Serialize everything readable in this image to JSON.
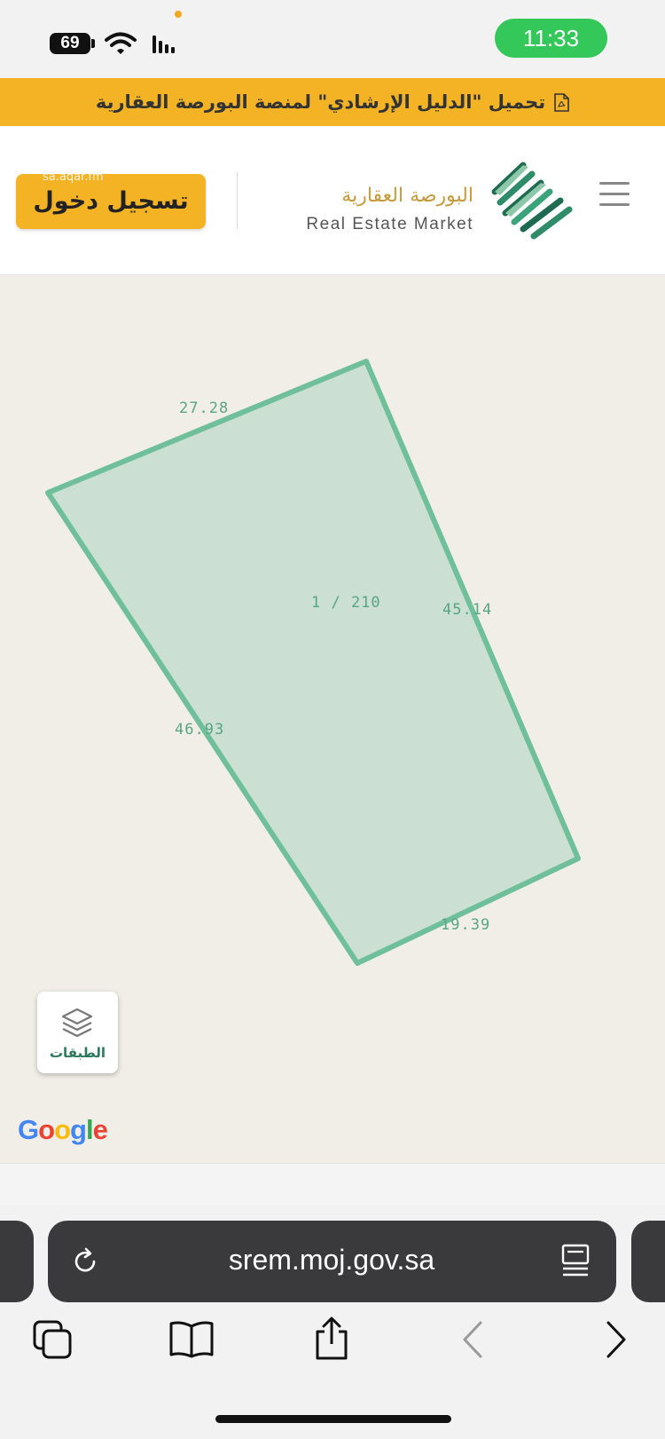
{
  "status_bar": {
    "battery": "69",
    "time": "11:33"
  },
  "banner": {
    "text": "تحميل \"الدليل الإرشادي\" لمنصة البورصة العقارية",
    "icon": "pdf-icon"
  },
  "header": {
    "login_label": "تسجيل دخول",
    "watermark": "sa.aqar.fm",
    "brand_ar": "البورصة العقارية",
    "brand_en": "Real Estate Market",
    "menu_icon": "hamburger-menu-icon",
    "logo_icon": "saudi-map-logo"
  },
  "map": {
    "parcel_label": "1 / 210",
    "dimensions": {
      "top": "27.28",
      "right": "45.14",
      "left": "46.93",
      "bottom": "19.39"
    },
    "parcel_fill": "#cbe0d3",
    "parcel_stroke": "#6fc09a",
    "background": "#f1eee7",
    "layers_label": "الطبقات",
    "google_logo": "Google"
  },
  "browser": {
    "url": "srem.moj.gov.sa",
    "toolbar": [
      "tabs-icon",
      "bookmarks-icon",
      "share-icon",
      "back-icon",
      "forward-icon"
    ]
  }
}
